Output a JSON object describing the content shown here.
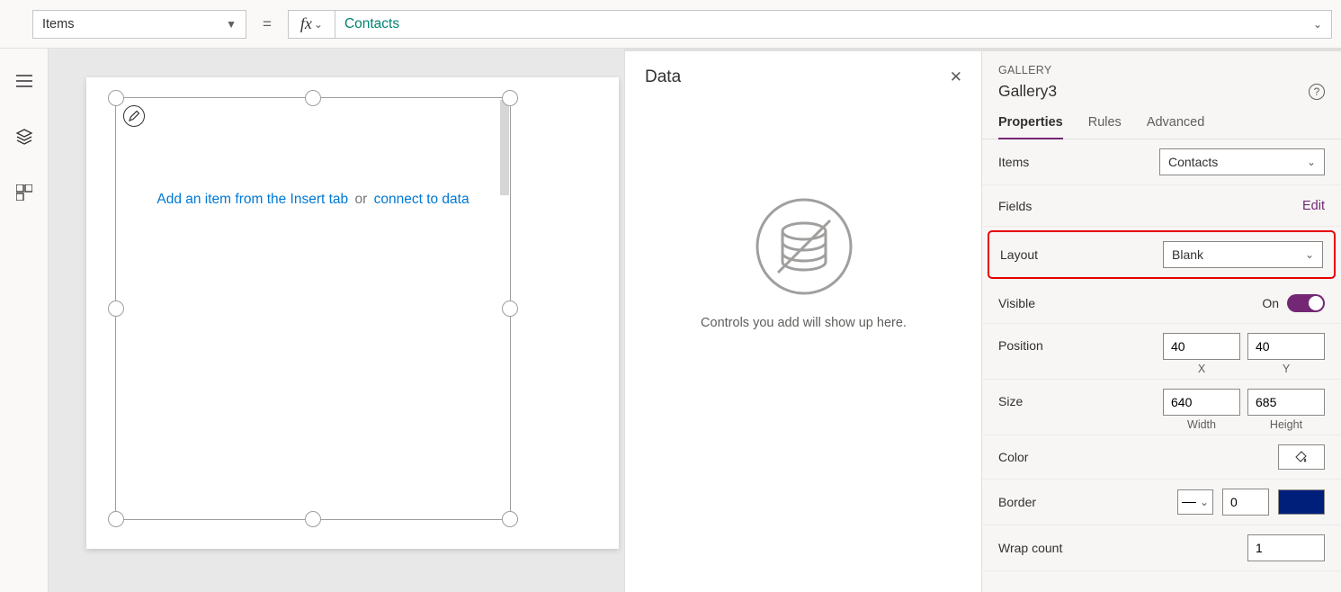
{
  "formulaBar": {
    "property": "Items",
    "formula": "Contacts"
  },
  "canvas": {
    "insertLink": "Add an item from the Insert tab",
    "or": "or",
    "connectLink": "connect to data"
  },
  "dataPanel": {
    "title": "Data",
    "empty": "Controls you add will show up here."
  },
  "propsPanel": {
    "category": "GALLERY",
    "name": "Gallery3",
    "tabs": {
      "properties": "Properties",
      "rules": "Rules",
      "advanced": "Advanced"
    },
    "items": {
      "label": "Items",
      "value": "Contacts"
    },
    "fields": {
      "label": "Fields",
      "edit": "Edit"
    },
    "layout": {
      "label": "Layout",
      "value": "Blank"
    },
    "visible": {
      "label": "Visible",
      "state": "On"
    },
    "position": {
      "label": "Position",
      "x": "40",
      "y": "40",
      "xLabel": "X",
      "yLabel": "Y"
    },
    "size": {
      "label": "Size",
      "w": "640",
      "h": "685",
      "wLabel": "Width",
      "hLabel": "Height"
    },
    "color": {
      "label": "Color"
    },
    "border": {
      "label": "Border",
      "width": "0"
    },
    "wrap": {
      "label": "Wrap count",
      "value": "1"
    }
  }
}
